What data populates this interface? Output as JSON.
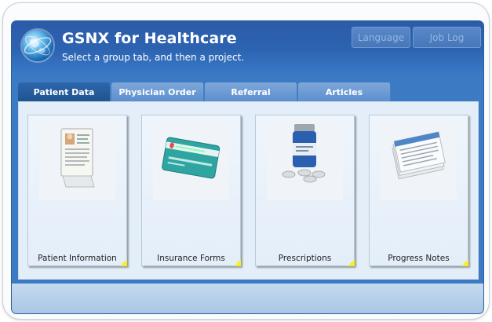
{
  "header": {
    "title": "GSNX for Healthcare",
    "subtitle": "Select a group tab, and then a project.",
    "buttons": {
      "language": "Language",
      "job_log": "Job Log"
    }
  },
  "tabs": [
    {
      "label": "Patient Data",
      "active": true
    },
    {
      "label": "Physician Order",
      "active": false
    },
    {
      "label": "Referral",
      "active": false
    },
    {
      "label": "Articles",
      "active": false
    }
  ],
  "projects": [
    {
      "label": "Patient Information",
      "icon": "patient-record-icon"
    },
    {
      "label": "Insurance Forms",
      "icon": "insurance-card-icon"
    },
    {
      "label": "Prescriptions",
      "icon": "medicine-bottle-icon"
    },
    {
      "label": "Progress Notes",
      "icon": "notes-stack-icon"
    }
  ],
  "colors": {
    "header": "#2b5ba9",
    "panel": "#e3eef9",
    "corner": "#f5ee2d"
  }
}
